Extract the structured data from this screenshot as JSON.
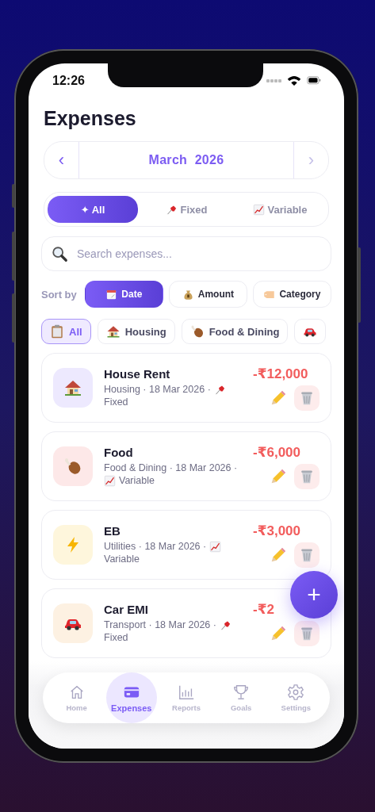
{
  "status_bar": {
    "time": "12:26"
  },
  "title": "Expenses",
  "month_nav": {
    "prev": "‹",
    "label": "March  2026",
    "next": "›"
  },
  "type_tabs": [
    {
      "label": "✦ All",
      "kind": "all",
      "selected": true
    },
    {
      "label": "Fixed",
      "kind": "fixed",
      "selected": false
    },
    {
      "label": "Variable",
      "kind": "variable",
      "selected": false
    }
  ],
  "search": {
    "placeholder": "Search expenses..."
  },
  "sort": {
    "label": "Sort by",
    "options": [
      {
        "label": "Date",
        "kind": "date",
        "selected": true
      },
      {
        "label": "Amount",
        "kind": "amount",
        "selected": false
      },
      {
        "label": "Category",
        "kind": "category",
        "selected": false
      }
    ]
  },
  "category_chips": [
    {
      "label": "All",
      "kind": "all",
      "selected": true
    },
    {
      "label": "Housing",
      "kind": "housing",
      "selected": false
    },
    {
      "label": "Food & Dining",
      "kind": "food",
      "selected": false
    },
    {
      "kind": "transport",
      "selected": false
    }
  ],
  "expenses": [
    {
      "name": "House Rent",
      "kind": "housing",
      "color": "#ede9fe",
      "meta": "Housing · 18 Mar 2026 ·",
      "type": {
        "kind": "fixed",
        "label": "Fixed"
      },
      "amount": "-₹12,000"
    },
    {
      "name": "Food",
      "kind": "food",
      "color": "#fde8e8",
      "meta": "Food & Dining · 18 Mar 2026 ·",
      "type": {
        "kind": "variable",
        "label": "Variable"
      },
      "amount": "-₹6,000"
    },
    {
      "name": "EB",
      "kind": "utilities",
      "color": "#fef6dc",
      "meta": "Utilities · 18 Mar 2026 ·",
      "type": {
        "kind": "variable",
        "label": "Variable"
      },
      "amount": "-₹3,000"
    },
    {
      "name": "Car EMI",
      "kind": "transport",
      "color": "#fdf1e2",
      "meta": "Transport · 18 Mar 2026 ·",
      "type": {
        "kind": "fixed",
        "label": "Fixed"
      },
      "amount": "-₹2"
    }
  ],
  "fab": {
    "label": "+"
  },
  "bottom_nav": [
    {
      "label": "Home",
      "kind": "home",
      "selected": false
    },
    {
      "label": "Expenses",
      "kind": "expenses",
      "selected": true
    },
    {
      "label": "Reports",
      "kind": "reports",
      "selected": false
    },
    {
      "label": "Goals",
      "kind": "goals",
      "selected": false
    },
    {
      "label": "Settings",
      "kind": "settings",
      "selected": false
    }
  ]
}
